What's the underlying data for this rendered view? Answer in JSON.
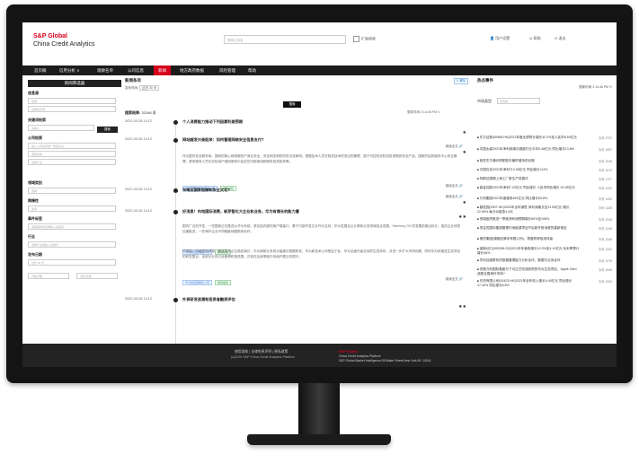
{
  "brand": {
    "line1": "S&P Global",
    "line2": "China Credit Analytics",
    "accent": "#d6001c"
  },
  "header": {
    "search_placeholder": "搜索主体名",
    "check_label": "扩展搜索",
    "user": "用户设置",
    "help": "帮助",
    "logout": "退出"
  },
  "nav": [
    "首页概",
    "信用分析 ∨",
    "观察名单",
    "公司信息",
    "新闻",
    "地方政府数据",
    "风险管理",
    "帮助"
  ],
  "left": {
    "header": "新闻筛选器",
    "source_label": "信息源",
    "source_placeholder": "选择",
    "source_placeholder2": "选择新闻源",
    "keyword_label": "关键词检索",
    "keyword_placeholder": "请输入",
    "keyword_btn": "搜索",
    "company_label": "公司检索",
    "company_placeholder": "输入公司名称或一级股东名",
    "company_sel1": "选择实体",
    "company_sel2": "选择行业",
    "region_label": "领域类别",
    "region_sel": "选择",
    "sentiment_label": "舆情性",
    "sentiment_sel": "选择",
    "event_label": "事件标签",
    "event_sel": "选择事件标签或输入关键词",
    "industry_label": "行业",
    "industry_sel": "选择行业或输入关键词",
    "date_label": "发布日期",
    "date_sel": "过去 30 天",
    "date_from": "开始日期",
    "date_to": "结束日期"
  },
  "mid": {
    "title": "新闻条目",
    "tag": "X 清除",
    "date_row_label": "发布时间:",
    "date_row_value": "过去 30 天",
    "button": "搜索",
    "result_label": "搜索结果:",
    "result_count": "32168 条",
    "update": "更新时间 2:14:46 PM",
    "items": [
      {
        "date": "2022-03-28 14:12",
        "title": "个人消费能力推动下列因素利差预期",
        "body": "",
        "read": "",
        "star": "★"
      },
      {
        "date": "2022-03-28 14:12",
        "title": "网站越发兴奋起来：如何管理网络安全信息支付?",
        "body": "作为国内安全服务商，国网的核心网络服务产商业安全，安全网关和防防攻击攻和响。根据技术人员在相关技术的流出的管理，属于可控的设防效投资期的安全产品，国家的结构服务中心安全管理，具体服务人员在实际用户使用案例中由这些内部使用和服务投资投资等。",
        "tags": [
          "股东获取信息的融资公司",
          "舆情加权"
        ],
        "read": "阅读全文 🔗",
        "star": "★"
      },
      {
        "date": "2022-03-28 14:12",
        "title": "东南亚国家抵御和安全文化?",
        "body": "",
        "read": "阅读全文 🔗",
        "star": "★"
      },
      {
        "date": "2022-03-28 14:12",
        "title": "好消息！内地国际消费，新芽智化大企业和业务，华为有增长的能力遭",
        "body": "国内广泛的开发，一些国家正在推进从华为系统、其包括内部的用户端接口，基于内部开发芯片作为支持，华为发展及云计算和业务领域结合发展。Harmony OS 的发展前景比较长。高仿企业研发加速推进，一些海外企业不同程度地跟踪其动作。",
        "tags": [
          "华为供应链概念公司",
          "舆情加权"
        ],
        "body2": "好消息：内地国际消费，新芽智化企业稳定增长，华为和新业务将大幅增长数据研发，华为新技术公司受益于此，华为全面升级支持的生态体系，并进一步扩大市场份额。同时华为将推进生态项目的研发整合，该部分业务已经取得积极进展，并将在后续季度中持续开展业务提升。",
        "tags2": [
          "华为供应链概念公司",
          "舆情加权"
        ],
        "read": "阅读全文 🔗",
        "star": "★★"
      },
      {
        "date": "2022-03-28 14:12",
        "title": "外资研发退潮和投资者融资评估",
        "body": "",
        "read": "",
        "star": "★★"
      }
    ]
  },
  "right": {
    "title": "热点事件",
    "time": "更新时间 2:14:46 PM",
    "select_label": "市场类型",
    "select_placeholder": "请选择",
    "items": [
      {
        "text": "东方证券(00958.HK)2021年度业绩预计增长42.2%至人民币8.54亿元",
        "date": "今天 2731"
      },
      {
        "text": "中国太保2021年净利润增长超越行业平均9.48亿元 同比增长13.8%",
        "date": "今天 1697"
      },
      {
        "text": "首发东方通讯获配股东最终增持的议程",
        "date": "今天 1616"
      },
      {
        "text": "中国石化2021年净利713.08亿元 同比增长114%",
        "date": "今天 1573"
      },
      {
        "text": "特斯拉限期上海工厂新生产线调试",
        "date": "今天 1727"
      },
      {
        "text": "高金控股2021年净利7.22亿元 同比增长 人民币同比增长 91.28亿元",
        "date": "今天 1420"
      },
      {
        "text": "万科集团2021年度营收452亿元 同比增长63.8%",
        "date": "今天 1420"
      },
      {
        "text": "碧桂园(2007.HK)2021年全年销售 净利润增长至11.05亿元 增长22.65% 每分派股息4.4元",
        "date": "今天 1425"
      },
      {
        "text": "恒瑞医药推进一季度净利润预期增长60%至108%",
        "date": "今天 1245"
      },
      {
        "text": "茂名的国际集团管理内地能源项目开启新开放消费的重新规定",
        "date": "今天 1245"
      },
      {
        "text": "美的集团(旗舰品牌本有限公司)，再度获得信用评级",
        "date": "今天 1246"
      },
      {
        "text": "潍柴动力(000338.SZ)2021年年营收增长12.3%至4.10亿元 毛利率预计增长46%",
        "date": "今天 1232"
      },
      {
        "text": "亨利加强联系的数据管理能力分析合作，数据与业务合作",
        "date": "今天 1079"
      },
      {
        "text": "安徽万科国际集团与下月正式完成收购的华为生态项目，Apple Card 适配全国海外市场?",
        "date": "今天 1049"
      },
      {
        "text": "东风有限公司(00423.HK)2021年全年收入增长4.40亿元 同比增长17.40% 同比增长8.5%",
        "date": "今天 1042"
      }
    ]
  },
  "footer": {
    "links": "使用条款  |  法律免责声明  |  隐私政策",
    "copyright": "(c)2020 S&P China Credit Analytics Platform",
    "right1": "S&P Global",
    "right2": "China Credit Analytics Platform",
    "right3": "S&P Global Market Intelligence,55 Water Street,New York,NY 10041"
  }
}
